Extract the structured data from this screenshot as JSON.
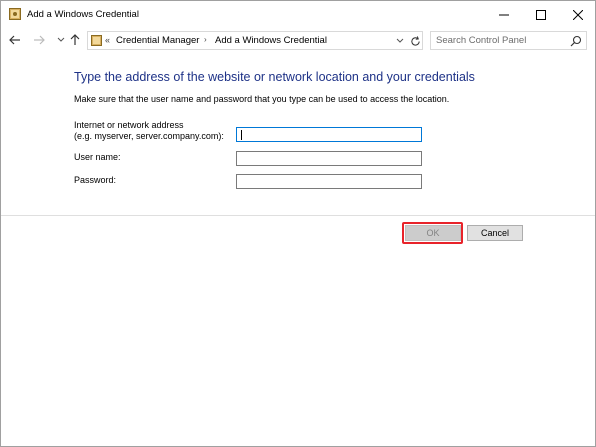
{
  "window": {
    "title": "Add a Windows Credential"
  },
  "navigation": {
    "breadcrumb_overflow": "«",
    "breadcrumb": [
      "Credential Manager",
      "Add a Windows Credential"
    ],
    "search_placeholder": "Search Control Panel"
  },
  "content": {
    "heading": "Type the address of the website or network location and your credentials",
    "description": "Make sure that the user name and password that you type can be used to access the location.",
    "fields": {
      "address_label_line1": "Internet or network address",
      "address_label_line2": "(e.g. myserver, server.company.com):",
      "address_value": "",
      "username_label": "User name:",
      "username_value": "",
      "password_label": "Password:",
      "password_value": ""
    }
  },
  "buttons": {
    "ok_label": "OK",
    "cancel_label": "Cancel"
  },
  "colors": {
    "heading": "#1e3287",
    "focus_border": "#0078d7",
    "highlight": "#e8232a"
  },
  "icons": {
    "app": "credential-manager-icon",
    "back": "arrow-left-icon",
    "forward": "arrow-right-icon",
    "recent": "chevron-down-icon",
    "up": "arrow-up-icon",
    "refresh": "refresh-icon",
    "search": "search-icon"
  }
}
